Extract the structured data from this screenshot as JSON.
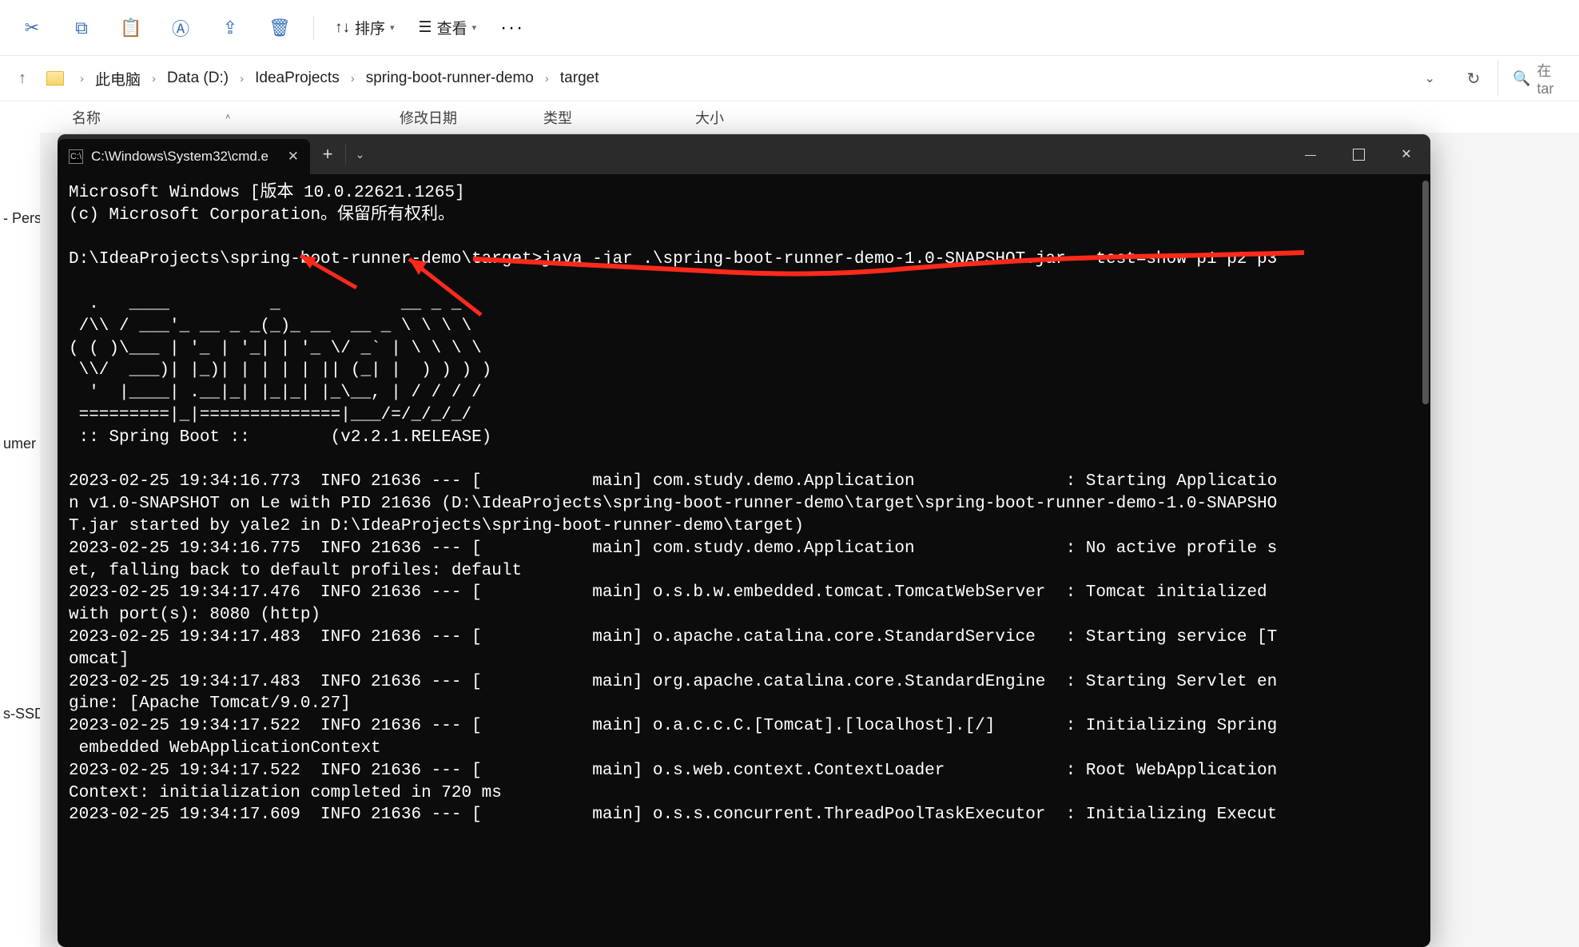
{
  "explorer": {
    "toolbar": {
      "sort_label": "排序",
      "view_label": "查看"
    },
    "breadcrumb": [
      "此电脑",
      "Data (D:)",
      "IdeaProjects",
      "spring-boot-runner-demo",
      "target"
    ],
    "search_placeholder": "在 tar",
    "columns": {
      "name": "名称",
      "date": "修改日期",
      "type": "类型",
      "size": "大小"
    },
    "sidebar": {
      "item0": "- Perso",
      "item1": "umer",
      "item2": "s-SSD ("
    }
  },
  "terminal": {
    "tab_title": "C:\\Windows\\System32\\cmd.e",
    "lines": {
      "l01": "Microsoft Windows [版本 10.0.22621.1265]",
      "l02": "(c) Microsoft Corporation。保留所有权利。",
      "l03": "",
      "l04": "D:\\IdeaProjects\\spring-boot-runner-demo\\target>java -jar .\\spring-boot-runner-demo-1.0-SNAPSHOT.jar --test=show p1 p2 p3",
      "l05": "",
      "l06": "  .   ____          _            __ _ _",
      "l07": " /\\\\ / ___'_ __ _ _(_)_ __  __ _ \\ \\ \\ \\",
      "l08": "( ( )\\___ | '_ | '_| | '_ \\/ _` | \\ \\ \\ \\",
      "l09": " \\\\/  ___)| |_)| | | | | || (_| |  ) ) ) )",
      "l10": "  '  |____| .__|_| |_|_| |_\\__, | / / / /",
      "l11": " =========|_|==============|___/=/_/_/_/",
      "l12": " :: Spring Boot ::        (v2.2.1.RELEASE)",
      "l13": "",
      "l14": "2023-02-25 19:34:16.773  INFO 21636 --- [           main] com.study.demo.Application               : Starting Applicatio",
      "l15": "n v1.0-SNAPSHOT on Le with PID 21636 (D:\\IdeaProjects\\spring-boot-runner-demo\\target\\spring-boot-runner-demo-1.0-SNAPSHO",
      "l16": "T.jar started by yale2 in D:\\IdeaProjects\\spring-boot-runner-demo\\target)",
      "l17": "2023-02-25 19:34:16.775  INFO 21636 --- [           main] com.study.demo.Application               : No active profile s",
      "l18": "et, falling back to default profiles: default",
      "l19": "2023-02-25 19:34:17.476  INFO 21636 --- [           main] o.s.b.w.embedded.tomcat.TomcatWebServer  : Tomcat initialized ",
      "l20": "with port(s): 8080 (http)",
      "l21": "2023-02-25 19:34:17.483  INFO 21636 --- [           main] o.apache.catalina.core.StandardService   : Starting service [T",
      "l22": "omcat]",
      "l23": "2023-02-25 19:34:17.483  INFO 21636 --- [           main] org.apache.catalina.core.StandardEngine  : Starting Servlet en",
      "l24": "gine: [Apache Tomcat/9.0.27]",
      "l25": "2023-02-25 19:34:17.522  INFO 21636 --- [           main] o.a.c.c.C.[Tomcat].[localhost].[/]       : Initializing Spring",
      "l26": " embedded WebApplicationContext",
      "l27": "2023-02-25 19:34:17.522  INFO 21636 --- [           main] o.s.web.context.ContextLoader            : Root WebApplication",
      "l28": "Context: initialization completed in 720 ms",
      "l29": "2023-02-25 19:34:17.609  INFO 21636 --- [           main] o.s.s.concurrent.ThreadPoolTaskExecutor  : Initializing Execut"
    }
  }
}
